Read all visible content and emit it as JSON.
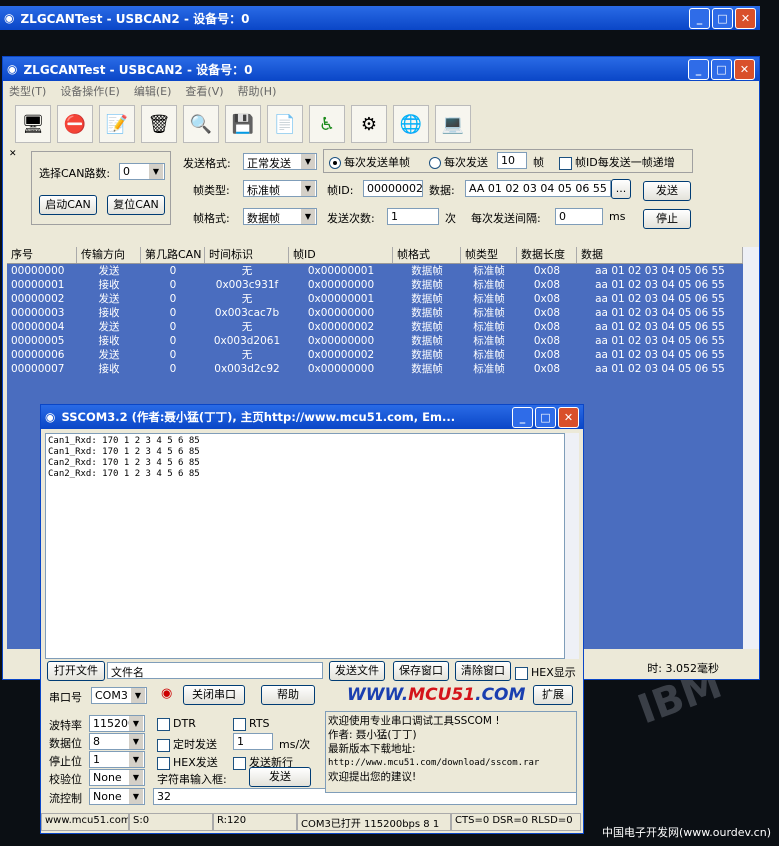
{
  "background_window": {
    "title": "ZLGCANTest - USBCAN2 - 设备号：0"
  },
  "main": {
    "title": "ZLGCANTest - USBCAN2 - 设备号：0",
    "menu": [
      "类型(T)",
      "设备操作(E)",
      "编辑(E)",
      "查看(V)",
      "帮助(H)"
    ],
    "left": {
      "can_route_label": "选择CAN路数:",
      "can_route_value": "0",
      "start_btn": "启动CAN",
      "reset_btn": "复位CAN"
    },
    "send_format_label": "发送格式:",
    "send_format_value": "正常发送",
    "frame_type_label": "帧类型:",
    "frame_type_value": "标准帧",
    "frame_format_label": "帧格式:",
    "frame_format_value": "数据帧",
    "radio_single": "每次发送单帧",
    "radio_multi": "每次发送",
    "multi_count": "10",
    "multi_unit": "帧",
    "id_inc_label": "帧ID每发送一帧递增",
    "frame_id_label": "帧ID:",
    "frame_id_value": "00000002",
    "data_label": "数据:",
    "data_value": "AA 01 02 03 04 05 06 55",
    "more_btn": "...",
    "send_count_label": "发送次数:",
    "send_count_value": "1",
    "send_count_unit": "次",
    "interval_label": "每次发送间隔:",
    "interval_value": "0",
    "interval_unit": "ms",
    "send_btn": "发送",
    "stop_btn": "停止",
    "columns": [
      "序号",
      "传输方向",
      "第几路CAN",
      "时间标识",
      "帧ID",
      "帧格式",
      "帧类型",
      "数据长度",
      "数据"
    ],
    "rows": [
      [
        "00000000",
        "发送",
        "0",
        "无",
        "0x00000001",
        "数据帧",
        "标准帧",
        "0x08",
        "aa 01 02 03 04 05 06 55"
      ],
      [
        "00000001",
        "接收",
        "0",
        "0x003c931f",
        "0x00000000",
        "数据帧",
        "标准帧",
        "0x08",
        "aa 01 02 03 04 05 06 55"
      ],
      [
        "00000002",
        "发送",
        "0",
        "无",
        "0x00000001",
        "数据帧",
        "标准帧",
        "0x08",
        "aa 01 02 03 04 05 06 55"
      ],
      [
        "00000003",
        "接收",
        "0",
        "0x003cac7b",
        "0x00000000",
        "数据帧",
        "标准帧",
        "0x08",
        "aa 01 02 03 04 05 06 55"
      ],
      [
        "00000004",
        "发送",
        "0",
        "无",
        "0x00000002",
        "数据帧",
        "标准帧",
        "0x08",
        "aa 01 02 03 04 05 06 55"
      ],
      [
        "00000005",
        "接收",
        "0",
        "0x003d2061",
        "0x00000000",
        "数据帧",
        "标准帧",
        "0x08",
        "aa 01 02 03 04 05 06 55"
      ],
      [
        "00000006",
        "发送",
        "0",
        "无",
        "0x00000002",
        "数据帧",
        "标准帧",
        "0x08",
        "aa 01 02 03 04 05 06 55"
      ],
      [
        "00000007",
        "接收",
        "0",
        "0x003d2c92",
        "0x00000000",
        "数据帧",
        "标准帧",
        "0x08",
        "aa 01 02 03 04 05 06 55"
      ]
    ],
    "status_time": "时:  3.052毫秒"
  },
  "sscom": {
    "title": "SSCOM3.2 (作者:聂小猛(丁丁), 主页http://www.mcu51.com, Em...",
    "lines": [
      "Can1_Rxd: 170 1 2 3 4 5 6 85",
      "Can1_Rxd: 170 1 2 3 4 5 6 85",
      "Can2_Rxd: 170 1 2 3 4 5 6 85",
      "Can2_Rxd: 170 1 2 3 4 5 6 85"
    ],
    "open_file_btn": "打开文件",
    "filename": "文件名",
    "send_file_btn": "发送文件",
    "save_btn": "保存窗口",
    "clear_btn": "清除窗口",
    "hex_show": "HEX显示",
    "port_label": "串口号",
    "port_value": "COM3",
    "close_port_btn": "关闭串口",
    "help_btn": "帮助",
    "expand_btn": "扩展",
    "logo_a": "WWW.",
    "logo_b": "MCU51",
    "logo_c": ".COM",
    "baud_label": "波特率",
    "baud_value": "115200",
    "databits_label": "数据位",
    "databits_value": "8",
    "stopbits_label": "停止位",
    "stopbits_value": "1",
    "parity_label": "校验位",
    "parity_value": "None",
    "flow_label": "流控制",
    "flow_value": "None",
    "dtr": "DTR",
    "rts": "RTS",
    "timed_send": "定时发送",
    "interval": "1",
    "interval_unit": "ms/次",
    "hex_send": "HEX发送",
    "newline": "发送新行",
    "input_label": "字符串输入框:",
    "send_btn": "发送",
    "input_value": "32",
    "info_lines": [
      "欢迎使用专业串口调试工具SSCOM !",
      "作者: 聂小猛(丁丁)",
      "最新版本下载地址:",
      "http://www.mcu51.com/download/sscom.rar",
      "欢迎提出您的建议!"
    ],
    "status": [
      "www.mcu51.com",
      "S:0",
      "R:120",
      "COM3已打开  115200bps  8 1",
      "CTS=0 DSR=0 RLSD=0"
    ]
  },
  "desktop": {
    "watermark": "中国电子开发网(www.ourdev.cn)"
  }
}
